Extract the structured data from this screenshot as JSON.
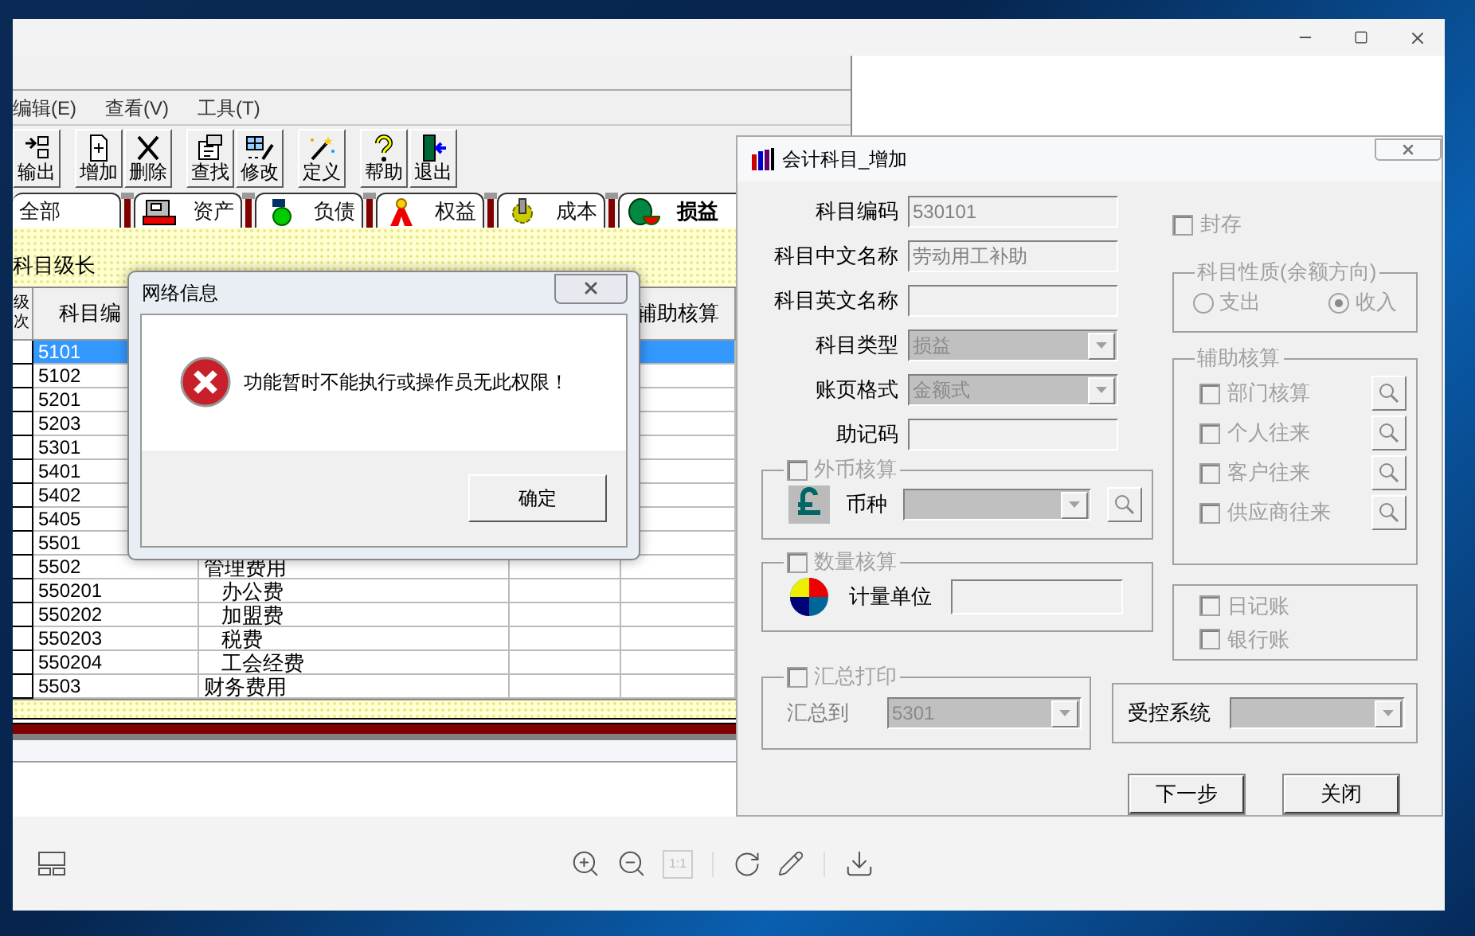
{
  "viewer": {
    "actual_size_button": {
      "label": "1:1",
      "disabled": true
    }
  },
  "ledger_window": {
    "menu": [
      "编辑(E)",
      "查看(V)",
      "工具(T)"
    ],
    "toolbar": [
      [
        {
          "kind": "export",
          "label": "输出"
        }
      ],
      [
        {
          "kind": "add",
          "label": "增加"
        },
        {
          "kind": "delete",
          "label": "删除"
        }
      ],
      [
        {
          "kind": "find",
          "label": "查找"
        },
        {
          "kind": "edit",
          "label": "修改"
        }
      ],
      [
        {
          "kind": "define",
          "label": "定义"
        }
      ],
      [
        {
          "kind": "help",
          "label": "帮助"
        },
        {
          "kind": "exit",
          "label": "退出"
        }
      ]
    ],
    "tabs": [
      {
        "kind": "all",
        "label": "全部",
        "selected": false
      },
      {
        "kind": "assets",
        "label": "资产",
        "selected": false
      },
      {
        "kind": "liabilities",
        "label": "负债",
        "selected": false
      },
      {
        "kind": "equity",
        "label": "权益",
        "selected": false
      },
      {
        "kind": "cost",
        "label": "成本",
        "selected": false
      },
      {
        "kind": "profit_loss",
        "label": "损益",
        "selected": true
      }
    ],
    "level_label": "科目级长",
    "columns": [
      "级次",
      "科目编",
      "辅助核算"
    ],
    "rows": [
      {
        "code": "5101",
        "selected": true
      },
      {
        "code": "5102",
        "selected": false
      },
      {
        "code": "5201",
        "selected": false
      },
      {
        "code": "5203",
        "selected": false
      },
      {
        "code": "5301",
        "selected": false
      },
      {
        "code": "5401",
        "selected": false
      },
      {
        "code": "5402",
        "selected": false
      },
      {
        "code": "5405",
        "selected": false
      },
      {
        "code": "5501",
        "selected": false
      },
      {
        "code": "5502",
        "name": "管理费用",
        "selected": false,
        "children": [
          {
            "code": "550201",
            "name": "办公费",
            "selected": false
          },
          {
            "code": "550202",
            "name": "加盟费",
            "selected": false
          },
          {
            "code": "550203",
            "name": "税费",
            "selected": false
          },
          {
            "code": "550204",
            "name": "工会经费",
            "selected": false
          }
        ]
      },
      {
        "code": "5503",
        "name": "财务费用",
        "selected": false
      }
    ]
  },
  "error_dialog": {
    "title": "网络信息",
    "message": "功能暂时不能执行或操作员无此权限！",
    "button": "确定"
  },
  "account_dialog": {
    "title": "会计科目_增加",
    "fields": [
      {
        "kind": "text",
        "label": "科目编码",
        "value": "530101"
      },
      {
        "kind": "text",
        "label": "科目中文名称",
        "value": "劳动用工补助"
      },
      {
        "kind": "text",
        "label": "科目英文名称"
      },
      {
        "kind": "select",
        "label": "科目类型",
        "value": "损益"
      },
      {
        "kind": "select",
        "label": "账页格式",
        "value": "金额式"
      },
      {
        "kind": "text",
        "label": "助记码"
      }
    ],
    "currency": {
      "label": "外币核算",
      "checked": false,
      "field_label": "币种"
    },
    "quantity": {
      "label": "数量核算",
      "checked": false,
      "field_label": "计量单位"
    },
    "summary_print": {
      "label": "汇总打印",
      "checked": false,
      "field_label": "汇总到",
      "value": "5301"
    },
    "sealed": {
      "label": "封存",
      "checked": false
    },
    "balance_direction": {
      "title": "科目性质(余额方向)",
      "options": [
        {
          "label": "支出",
          "selected": false
        },
        {
          "label": "收入",
          "selected": true
        }
      ]
    },
    "auxiliary": {
      "title": "辅助核算",
      "items": [
        {
          "label": "部门核算",
          "checked": false
        },
        {
          "label": "个人往来",
          "checked": false
        },
        {
          "label": "客户往来",
          "checked": false
        },
        {
          "label": "供应商往来",
          "checked": false
        }
      ]
    },
    "books": [
      {
        "label": "日记账",
        "checked": false
      },
      {
        "label": "银行账",
        "checked": false
      }
    ],
    "controlled_system": {
      "label": "受控系统"
    },
    "buttons": [
      "下一步",
      "关闭"
    ]
  }
}
